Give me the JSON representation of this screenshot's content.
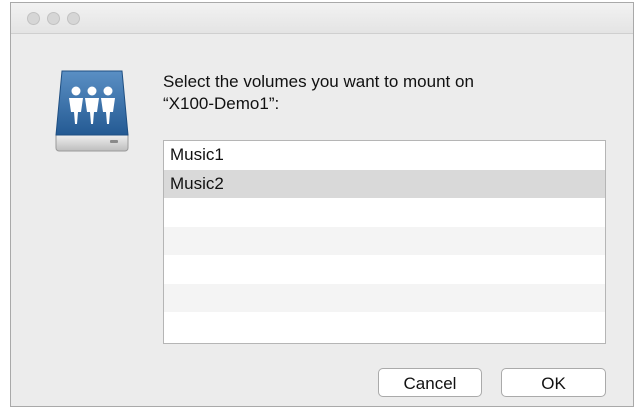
{
  "dialog": {
    "prompt": "Select the volumes you want to mount on\n“X100-Demo1”:"
  },
  "volumes": {
    "items": [
      "Music1",
      "Music2",
      "",
      "",
      "",
      "",
      ""
    ],
    "selected": "Music2"
  },
  "buttons": {
    "cancel_label": "Cancel",
    "ok_label": "OK"
  },
  "icons": {
    "server": "shared-server-icon"
  },
  "colors": {
    "icon_blue": "#2f6aa3",
    "selection": "#d9d9d9"
  }
}
